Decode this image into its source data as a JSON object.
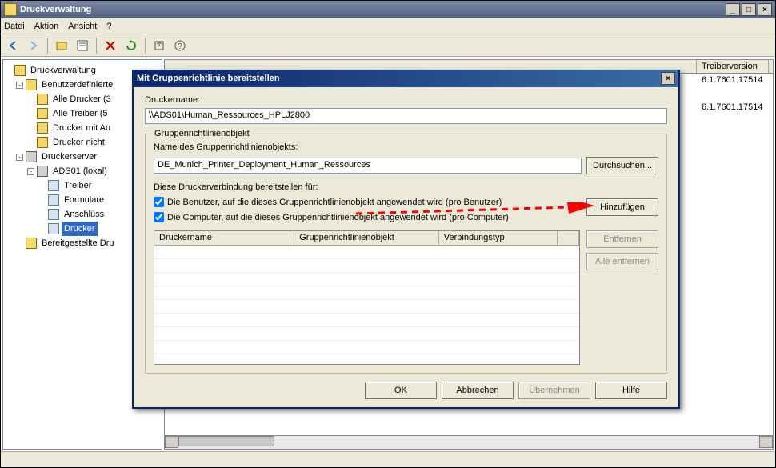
{
  "window": {
    "title": "Druckverwaltung",
    "menus": [
      "Datei",
      "Aktion",
      "Ansicht",
      "?"
    ]
  },
  "tree": {
    "root": "Druckverwaltung",
    "custom": "Benutzerdefinierte",
    "all_printers": "Alle Drucker (3",
    "all_drivers": "Alle Treiber (5",
    "printers_with": "Drucker mit Au",
    "printers_not": "Drucker nicht",
    "servers": "Druckerserver",
    "server1": "ADS01 (lokal)",
    "drivers": "Treiber",
    "forms": "Formulare",
    "ports": "Anschlüss",
    "printers": "Drucker",
    "provided": "Bereitgestellte Dru"
  },
  "list": {
    "col_version": "Treiberversion",
    "rows": [
      "6.1.7601.17514",
      "6.1.7601.17514"
    ]
  },
  "dialog": {
    "title": "Mit Gruppenrichtlinie bereitstellen",
    "printer_label": "Druckername:",
    "printer_value": "\\\\ADS01\\Human_Ressources_HPLJ2800",
    "gpo_group": "Gruppenrichtlinienobjekt",
    "gpo_name_label": "Name des Gruppenrichtlinienobjekts:",
    "gpo_name_value": "DE_Munich_Printer_Deployment_Human_Ressources",
    "browse": "Durchsuchen...",
    "deploy_label": "Diese Druckerverbindung bereitstellen für:",
    "cb_user": "Die Benutzer, auf die dieses Gruppenrichtlinienobjekt angewendet wird (pro Benutzer)",
    "cb_computer": "Die Computer, auf die dieses Gruppenrichtlinienobjekt angewendet wird (pro Computer)",
    "add": "Hinzufügen",
    "remove": "Entfernen",
    "remove_all": "Alle entfernen",
    "tbl_col1": "Druckername",
    "tbl_col2": "Gruppenrichtlinienobjekt",
    "tbl_col3": "Verbindungstyp",
    "ok": "OK",
    "cancel": "Abbrechen",
    "apply": "Übernehmen",
    "help": "Hilfe"
  },
  "colors": {
    "titlebar_active": "#0a246a",
    "annotation": "#ff0000"
  }
}
